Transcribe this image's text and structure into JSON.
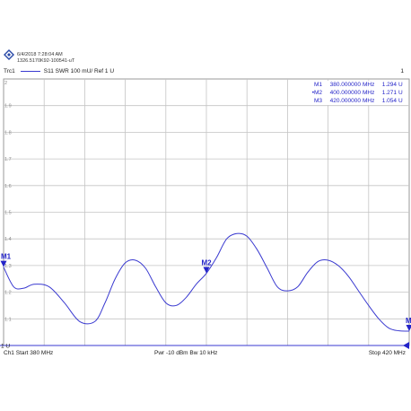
{
  "header": {
    "timestamp": "6/4/2018 7:28:04 AM",
    "instrument_id": "1326.5170K92-100541-uT"
  },
  "trace": {
    "name": "Trc1",
    "desc": "S11  SWR  100 mU/ Ref 1 U",
    "channel_num": "1",
    "color": "#3a3ad0"
  },
  "footer": {
    "start": "Ch1  Start  380 MHz",
    "mid": "Pwr  -10 dBm  Bw  10 kHz",
    "stop": "Stop  420 MHz"
  },
  "markers": [
    {
      "id": "M1",
      "active": "",
      "freq": "380.000000",
      "funit": "MHz",
      "val": "1.294",
      "vunit": "U"
    },
    {
      "id": "M2",
      "active": "•",
      "freq": "400.000000",
      "funit": "MHz",
      "val": "1.271",
      "vunit": "U"
    },
    {
      "id": "M3",
      "active": "",
      "freq": "420.000000",
      "funit": "MHz",
      "val": "1.054",
      "vunit": "U"
    }
  ],
  "chart_data": {
    "type": "line",
    "xlim": [
      380,
      420
    ],
    "ylim": [
      1,
      2
    ],
    "ytick_labels": [
      "2",
      "1.9",
      "1.8",
      "1.7",
      "1.6",
      "1.5",
      "1.4",
      "1.3",
      "1.2",
      "1.1",
      "1 U"
    ],
    "ytick_values": [
      2,
      1.9,
      1.8,
      1.7,
      1.6,
      1.5,
      1.4,
      1.3,
      1.2,
      1.1,
      1
    ],
    "series": [
      {
        "x": [
          380,
          381,
          382,
          383,
          384.5,
          386,
          387.5,
          389,
          390,
          391,
          392,
          393,
          394,
          395,
          396,
          397,
          398,
          399,
          400,
          401,
          402,
          403,
          404,
          405,
          406,
          407,
          408,
          409,
          410,
          411,
          412,
          413,
          414,
          415,
          416,
          417,
          418,
          419,
          420
        ],
        "y": [
          1.294,
          1.22,
          1.215,
          1.23,
          1.22,
          1.16,
          1.09,
          1.09,
          1.16,
          1.25,
          1.31,
          1.32,
          1.29,
          1.22,
          1.16,
          1.15,
          1.18,
          1.23,
          1.271,
          1.33,
          1.4,
          1.42,
          1.41,
          1.36,
          1.29,
          1.22,
          1.205,
          1.22,
          1.275,
          1.315,
          1.32,
          1.3,
          1.26,
          1.205,
          1.15,
          1.1,
          1.065,
          1.055,
          1.054
        ]
      }
    ],
    "marker_points": [
      {
        "label": "M1",
        "x": 380,
        "y": 1.294
      },
      {
        "label": "M2",
        "x": 400,
        "y": 1.271
      },
      {
        "label": "M3",
        "x": 420,
        "y": 1.054
      }
    ],
    "grid": true
  }
}
